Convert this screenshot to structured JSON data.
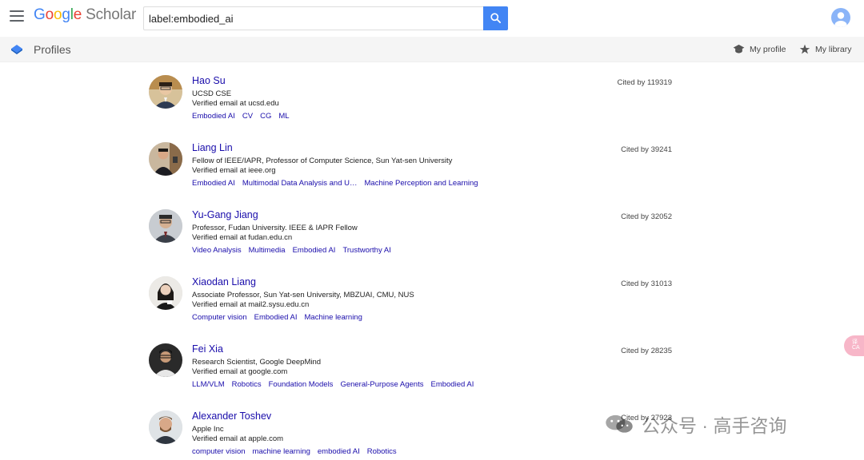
{
  "header": {
    "logo_letters": [
      "G",
      "o",
      "o",
      "g",
      "l",
      "e"
    ],
    "logo_suffix": "Scholar",
    "search_value": "label:embodied_ai"
  },
  "subbar": {
    "title": "Profiles",
    "my_profile": "My profile",
    "my_library": "My library"
  },
  "profiles": [
    {
      "name": "Hao Su",
      "affiliation": "UCSD CSE",
      "email": "Verified email at ucsd.edu",
      "cited": "Cited by 119319",
      "interests": [
        "Embodied AI",
        "CV",
        "CG",
        "ML"
      ]
    },
    {
      "name": "Liang Lin",
      "affiliation": "Fellow of IEEE/IAPR, Professor of Computer Science, Sun Yat-sen University",
      "email": "Verified email at ieee.org",
      "cited": "Cited by 39241",
      "interests": [
        "Embodied AI",
        "Multimodal Data Analysis and U…",
        "Machine Perception and Learning"
      ]
    },
    {
      "name": "Yu-Gang Jiang",
      "affiliation": "Professor, Fudan University. IEEE & IAPR Fellow",
      "email": "Verified email at fudan.edu.cn",
      "cited": "Cited by 32052",
      "interests": [
        "Video Analysis",
        "Multimedia",
        "Embodied AI",
        "Trustworthy AI"
      ]
    },
    {
      "name": "Xiaodan Liang",
      "affiliation": "Associate Professor, Sun Yat-sen University, MBZUAI, CMU, NUS",
      "email": "Verified email at mail2.sysu.edu.cn",
      "cited": "Cited by 31013",
      "interests": [
        "Computer vision",
        "Embodied AI",
        "Machine learning"
      ]
    },
    {
      "name": "Fei Xia",
      "affiliation": "Research Scientist, Google DeepMind",
      "email": "Verified email at google.com",
      "cited": "Cited by 28235",
      "interests": [
        "LLM/VLM",
        "Robotics",
        "Foundation Models",
        "General-Purpose Agents",
        "Embodied AI"
      ]
    },
    {
      "name": "Alexander Toshev",
      "affiliation": "Apple Inc",
      "email": "Verified email at apple.com",
      "cited": "Cited by 27923",
      "interests": [
        "computer vision",
        "machine learning",
        "embodied AI",
        "Robotics"
      ]
    }
  ],
  "watermark": {
    "text": "公众号 · 高手咨询"
  },
  "side_float": {
    "text": "译\nCA"
  },
  "colors": {
    "link": "#1a0dab",
    "search_button": "#4285f4",
    "subbar_bg": "#f5f5f5"
  }
}
